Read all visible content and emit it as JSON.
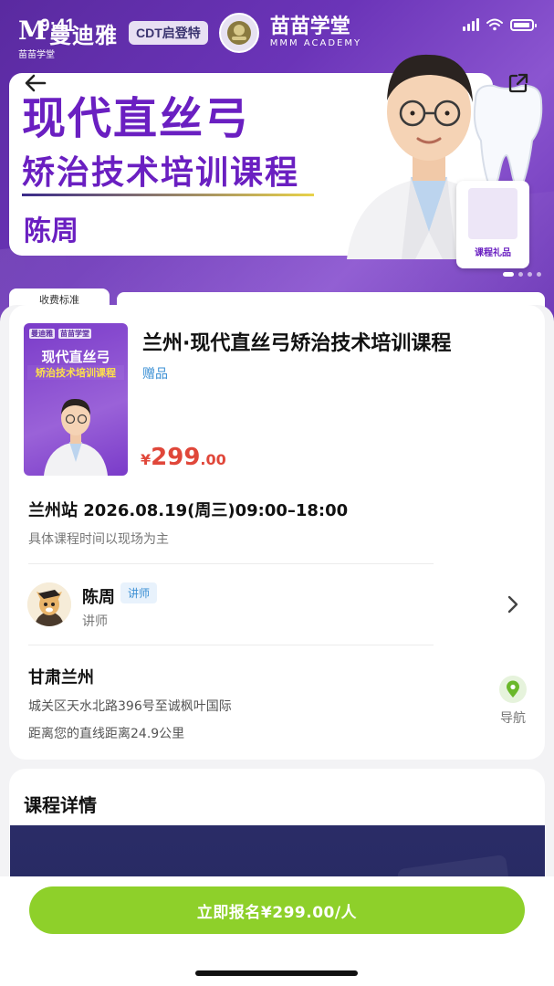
{
  "status_bar": {
    "time": "9:41"
  },
  "banner": {
    "brand_1": "曼迪雅",
    "brand_1_sub": "苗苗学堂",
    "brand_2": "CDT启登特",
    "brand_3": "苗苗学堂",
    "brand_3_sub": "MMM ACADEMY",
    "title_line_1": "现代直丝弓",
    "title_line_2": "矫治技术培训课程",
    "presenter_name": "陈周",
    "gift_card_label": "课程礼品",
    "schedule_tag": "收费标准",
    "back_icon": "arrow-left-icon",
    "share_icon": "share-icon",
    "carousel_active_index": 0,
    "carousel_count": 4
  },
  "product": {
    "cover": {
      "logo_1": "曼迪雅",
      "logo_2": "苗苗学堂",
      "title_1": "现代直丝弓",
      "title_2": "矫治技术培训课程"
    },
    "title": "兰州·现代直丝弓矫治技术培训课程",
    "gift_label": "赠品",
    "price_symbol": "¥",
    "price_int": "299",
    "price_dec": ".00"
  },
  "session": {
    "text": "兰州站 2026.08.19(周三)09:00–18:00",
    "note": "具体课程时间以现场为主"
  },
  "teacher": {
    "name": "陈周",
    "tag": "讲师",
    "role": "讲师"
  },
  "venue": {
    "title": "甘肃兰州",
    "address": "城关区天水北路396号至诚枫叶国际",
    "distance": "距离您的直线距离24.9公里",
    "nav_label": "导航"
  },
  "details": {
    "title": "课程详情"
  },
  "cta": {
    "label": "立即报名¥299.00/人"
  },
  "colors": {
    "accent_green": "#8ed02a",
    "price_red": "#e0473a",
    "banner_purple": "#6a1fc1",
    "link_blue": "#3a8fd4"
  }
}
